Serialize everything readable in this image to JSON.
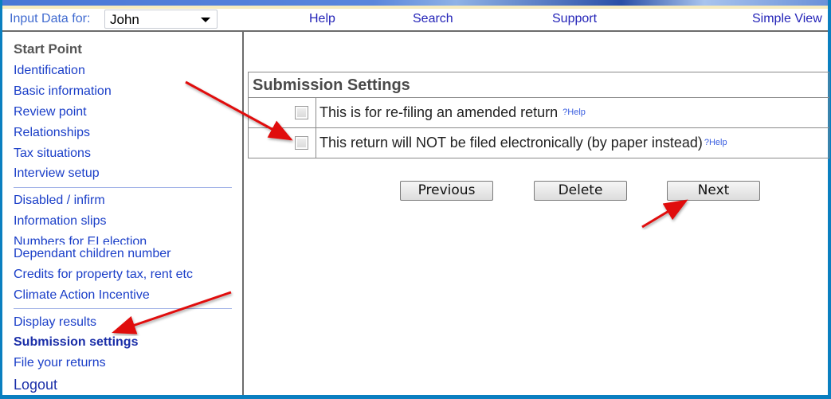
{
  "header": {
    "input_label": "Input Data for:",
    "person_selected": "John",
    "nav": {
      "help": "Help",
      "search": "Search",
      "support": "Support",
      "simple_view": "Simple View"
    }
  },
  "sidebar": {
    "start_point": "Start Point",
    "group1": [
      "Identification",
      "Basic information",
      "Review point",
      "Relationships",
      "Tax situations",
      "Interview setup"
    ],
    "group2": [
      "Disabled / infirm",
      "Information slips",
      "Numbers for EI election",
      "Dependant children number",
      "Credits for property tax, rent etc",
      "Climate Action Incentive"
    ],
    "group3": [
      "Display results",
      "Submission settings",
      "File your returns"
    ],
    "active_item": "Submission settings",
    "logout": "Logout"
  },
  "main": {
    "section_title": "Submission Settings",
    "options": [
      {
        "label": "This is for re-filing an amended return",
        "help": "?Help",
        "checked": false
      },
      {
        "label": "This return will NOT be filed electronically (by paper instead)",
        "help": "?Help",
        "checked": false
      }
    ],
    "buttons": {
      "previous": "Previous",
      "delete": "Delete",
      "next": "Next"
    }
  },
  "annotation_color": "#e01010"
}
